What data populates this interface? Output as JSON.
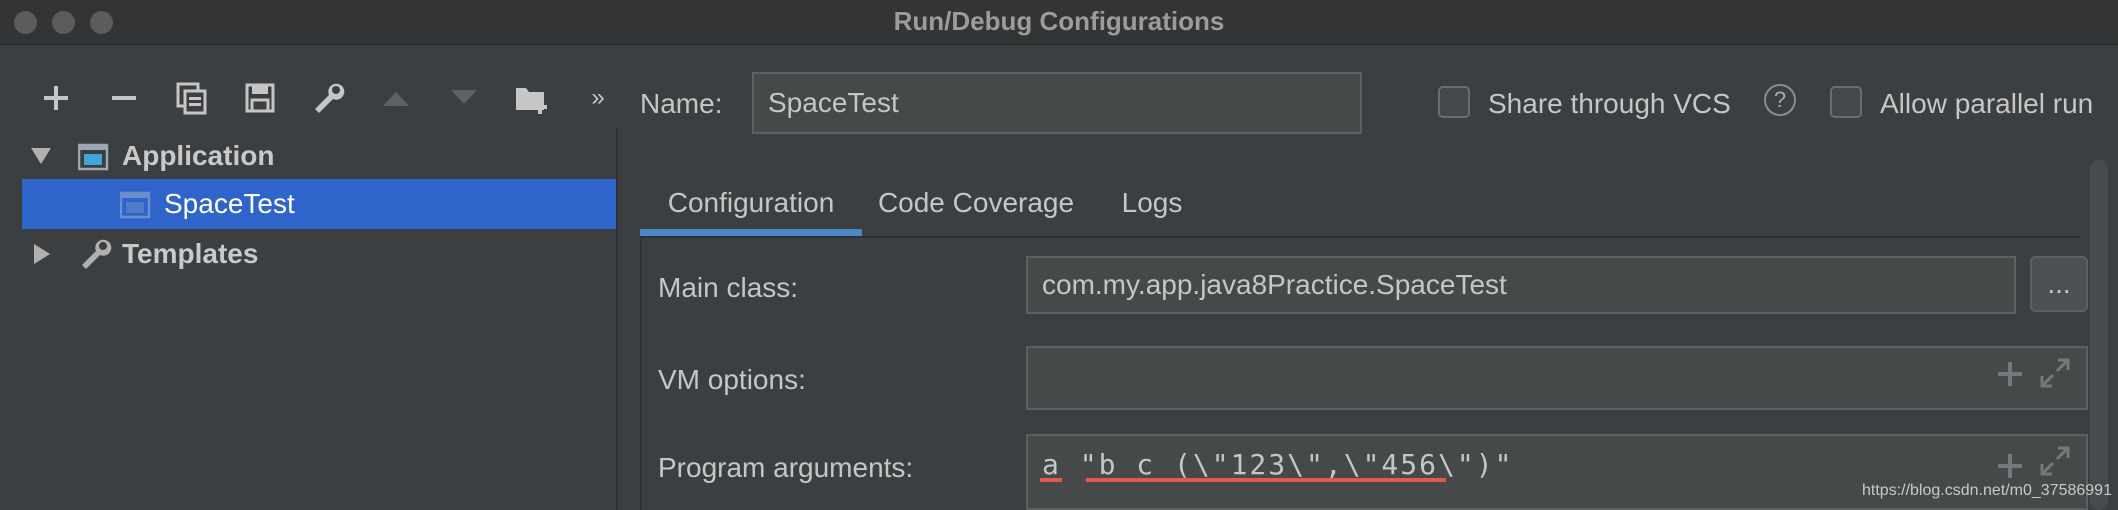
{
  "window": {
    "title": "Run/Debug Configurations"
  },
  "toolbar": {
    "buttons": [
      {
        "name": "add",
        "glyph": "+"
      },
      {
        "name": "remove",
        "glyph": "−"
      },
      {
        "name": "copy",
        "glyph": "⧉"
      },
      {
        "name": "save",
        "glyph": "💾"
      },
      {
        "name": "edit-defaults",
        "glyph": "🔧"
      },
      {
        "name": "move-up",
        "glyph": "▲"
      },
      {
        "name": "move-down",
        "glyph": "▼"
      },
      {
        "name": "new-folder",
        "glyph": "📁"
      },
      {
        "name": "more",
        "glyph": "»"
      }
    ]
  },
  "tree": {
    "items": [
      {
        "label": "Application",
        "expanded": true,
        "icon": "application-icon"
      },
      {
        "label": "SpaceTest",
        "selected": true,
        "icon": "config-icon"
      },
      {
        "label": "Templates",
        "expanded": false,
        "icon": "wrench-icon"
      }
    ]
  },
  "form": {
    "name_label": "Name:",
    "name_value": "SpaceTest",
    "share_label": "Share through VCS",
    "help_glyph": "?",
    "parallel_label": "Allow parallel run",
    "main_class_label": "Main class:",
    "main_class_value": "com.my.app.java8Practice.SpaceTest",
    "ellipsis": "...",
    "vm_options_label": "VM options:",
    "vm_options_value": "",
    "program_args_label": "Program arguments:",
    "program_args_value": "a \"b c (\\\"123\\\",\\\"456\\\")\""
  },
  "tabs": [
    {
      "label": "Configuration",
      "active": true
    },
    {
      "label": "Code Coverage",
      "active": false
    },
    {
      "label": "Logs",
      "active": false
    }
  ],
  "watermark": "https://blog.csdn.net/m0_37586991",
  "colors": {
    "background": "#3c3f41",
    "selection": "#2f65ca",
    "tab_accent": "#4a88c7",
    "annotation_underline": "#e05a4e"
  }
}
